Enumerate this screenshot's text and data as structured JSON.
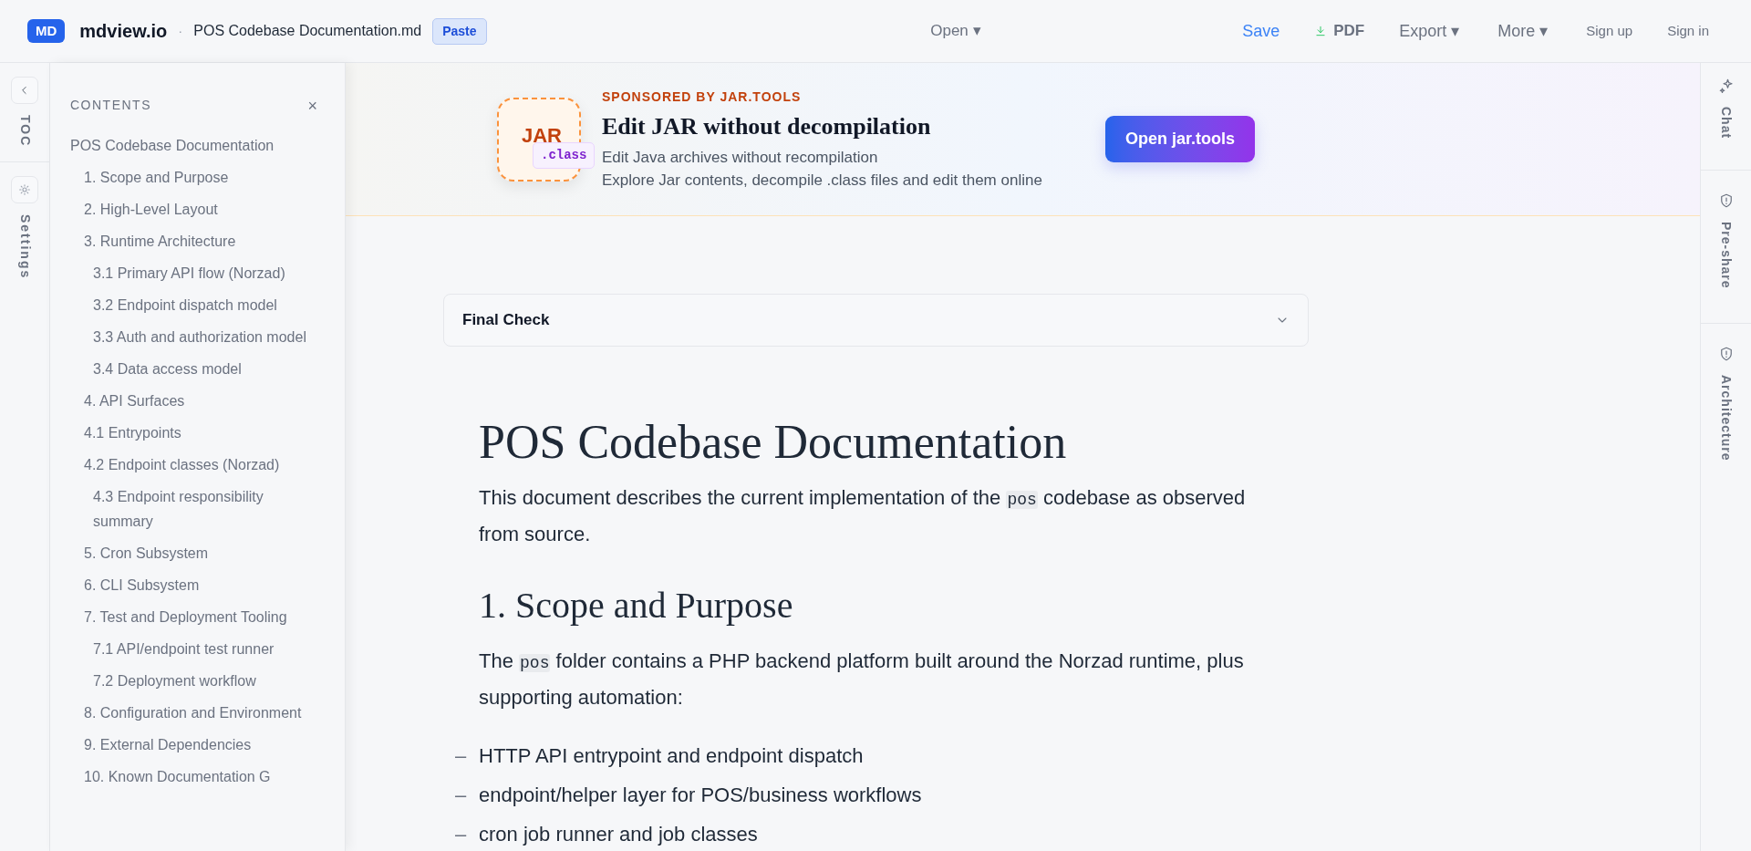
{
  "topbar": {
    "logo_badge": "MD",
    "brand": "mdview.io",
    "separator": "·",
    "filename": "POS Codebase Documentation.md",
    "paste": "Paste",
    "open": "Open ▾",
    "actions": [
      {
        "kind": "link",
        "label": "Save"
      },
      {
        "kind": "download",
        "label": "PDF"
      },
      {
        "kind": "menu",
        "label": "Export ▾"
      },
      {
        "kind": "menu",
        "label": "More ▾"
      },
      {
        "kind": "auth",
        "label": "Sign up"
      },
      {
        "kind": "auth",
        "label": "Sign in"
      }
    ]
  },
  "left_rail": [
    {
      "kind": "collapse",
      "label": "TOC"
    },
    {
      "kind": "settings",
      "label": "Settings"
    }
  ],
  "toc": {
    "title": "CONTENTS",
    "close": "×",
    "items": [
      {
        "label": "POS Codebase Documentation",
        "children": [
          {
            "label": "1. Scope and Purpose"
          },
          {
            "label": "2. High-Level Layout"
          },
          {
            "label": "3. Runtime Architecture",
            "children": [
              {
                "label": "3.1 Primary API flow (Norzad)"
              },
              {
                "label": "3.2 Endpoint dispatch model"
              },
              {
                "label": "3.3 Auth and authorization model"
              },
              {
                "label": "3.4 Data access model"
              }
            ]
          },
          {
            "label": "4. API Surfaces"
          },
          {
            "label": "4.1 Entrypoints"
          },
          {
            "label": "4.2 Endpoint classes (Norzad)",
            "children": [
              {
                "label": "4.3 Endpoint responsibility summary"
              }
            ]
          },
          {
            "label": "5. Cron Subsystem"
          },
          {
            "label": "6. CLI Subsystem"
          },
          {
            "label": "7. Test and Deployment Tooling",
            "children": [
              {
                "label": "7.1 API/endpoint test runner"
              },
              {
                "label": "7.2 Deployment workflow"
              }
            ]
          },
          {
            "label": "8. Configuration and Environment"
          },
          {
            "label": "9. External Dependencies"
          },
          {
            "label": "10. Known Documentation G"
          }
        ]
      }
    ]
  },
  "banner": {
    "sponsor": "SPONSORED BY JAR.TOOLS",
    "icon_text": "JAR",
    "chip": ".class",
    "title": "Edit JAR without decompilation",
    "lines": [
      "Edit Java archives without recompilation",
      "Explore Jar contents, decompile .class files and edit them online"
    ],
    "button": "Open jar.tools"
  },
  "accordion": {
    "title": "Final Check",
    "expanded": false
  },
  "document": [
    {
      "kind": "h1",
      "text": "POS Codebase Documentation"
    },
    {
      "kind": "p",
      "parts": [
        {
          "kind": "text",
          "text": "This document describes the current implementation of the "
        },
        {
          "kind": "code",
          "text": "pos"
        },
        {
          "kind": "text",
          "text": " codebase as observed from source."
        }
      ]
    },
    {
      "kind": "h2",
      "text": "1. Scope and Purpose"
    },
    {
      "kind": "p",
      "parts": [
        {
          "kind": "text",
          "text": "The "
        },
        {
          "kind": "code",
          "text": "pos"
        },
        {
          "kind": "text",
          "text": " folder contains a PHP backend platform built around the Norzad runtime, plus supporting automation:"
        }
      ]
    },
    {
      "kind": "ul",
      "marker": "–",
      "items": [
        "HTTP API entrypoint and endpoint dispatch",
        "endpoint/helper layer for POS/business workflows",
        "cron job runner and job classes"
      ]
    }
  ],
  "right_rail": [
    {
      "kind": "sparkle",
      "label": "Chat"
    },
    {
      "kind": "shield",
      "label": "Pre-share"
    },
    {
      "kind": "shield",
      "label": "Architecture"
    }
  ]
}
